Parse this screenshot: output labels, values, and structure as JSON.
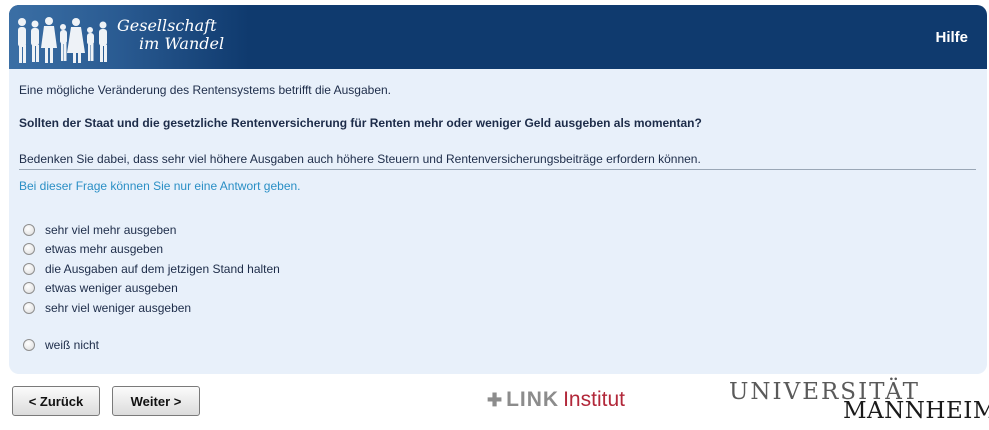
{
  "header": {
    "logo_line1": "Gesellschaft",
    "logo_line2": "im Wandel",
    "help_label": "Hilfe"
  },
  "question": {
    "intro": "Eine mögliche Veränderung des Rentensystems betrifft die Ausgaben.",
    "text": "Sollten der Staat und die gesetzliche Rentenversicherung für Renten mehr oder weniger Geld ausgeben als momentan?",
    "note": "Bedenken Sie dabei, dass sehr viel höhere Ausgaben auch höhere Steuern und Rentenversicherungsbeiträge erfordern können.",
    "instruction": "Bei dieser Frage können Sie nur eine Antwort geben.",
    "options": [
      "sehr viel mehr ausgeben",
      "etwas mehr ausgeben",
      "die Ausgaben auf dem jetzigen Stand halten",
      "etwas weniger ausgeben",
      "sehr viel weniger ausgeben",
      "weiß nicht"
    ]
  },
  "nav": {
    "back_label": "< Zurück",
    "next_label": "Weiter >"
  },
  "footer": {
    "link_word": "LINK",
    "link_suffix": "Institut",
    "uni_line1": "UNIVERSITÄT",
    "uni_line2": "MANNHEIM"
  },
  "colors": {
    "header_bg": "#0f3a6e",
    "panel_bg": "#e8f0fa",
    "instruction_text": "#2a8fc5",
    "link_red": "#b2283a"
  }
}
